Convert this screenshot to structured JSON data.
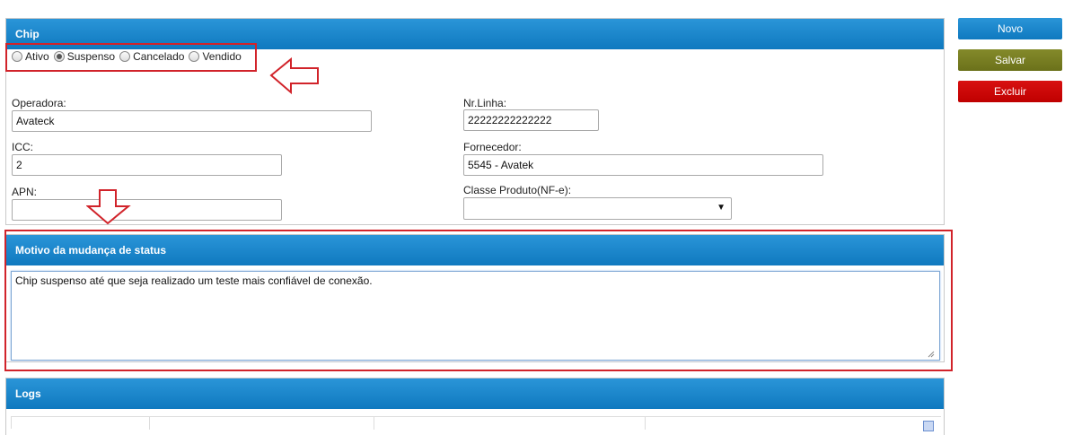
{
  "chip_panel": {
    "title": "Chip",
    "status_options": [
      {
        "label": "Ativo",
        "checked": false
      },
      {
        "label": "Suspenso",
        "checked": true
      },
      {
        "label": "Cancelado",
        "checked": false
      },
      {
        "label": "Vendido",
        "checked": false
      }
    ],
    "operadora": {
      "label": "Operadora:",
      "value": "Avateck"
    },
    "nr_linha": {
      "label": "Nr.Linha:",
      "value": "22222222222222"
    },
    "icc": {
      "label": "ICC:",
      "value": "2"
    },
    "fornecedor": {
      "label": "Fornecedor:",
      "value": "5545 - Avatek"
    },
    "apn": {
      "label": "APN:",
      "value": ""
    },
    "classe_produto": {
      "label": "Classe Produto(NF-e):",
      "value": ""
    }
  },
  "motivo_panel": {
    "title": "Motivo da mudança de status",
    "text": "Chip suspenso até que seja realizado um teste mais confiável de conexão."
  },
  "logs_panel": {
    "title": "Logs"
  },
  "actions": {
    "novo_label": "Novo",
    "salvar_label": "Salvar",
    "excluir_label": "Excluir"
  },
  "colors": {
    "header_blue": "#1786cc",
    "salvar_olive": "#787e22",
    "excluir_red": "#cc0000",
    "annotation_red": "#d1232a"
  },
  "icons": [
    "arrow-left-annotation-icon",
    "arrow-down-annotation-icon",
    "dropdown-arrow-icon",
    "resize-grip-icon"
  ]
}
